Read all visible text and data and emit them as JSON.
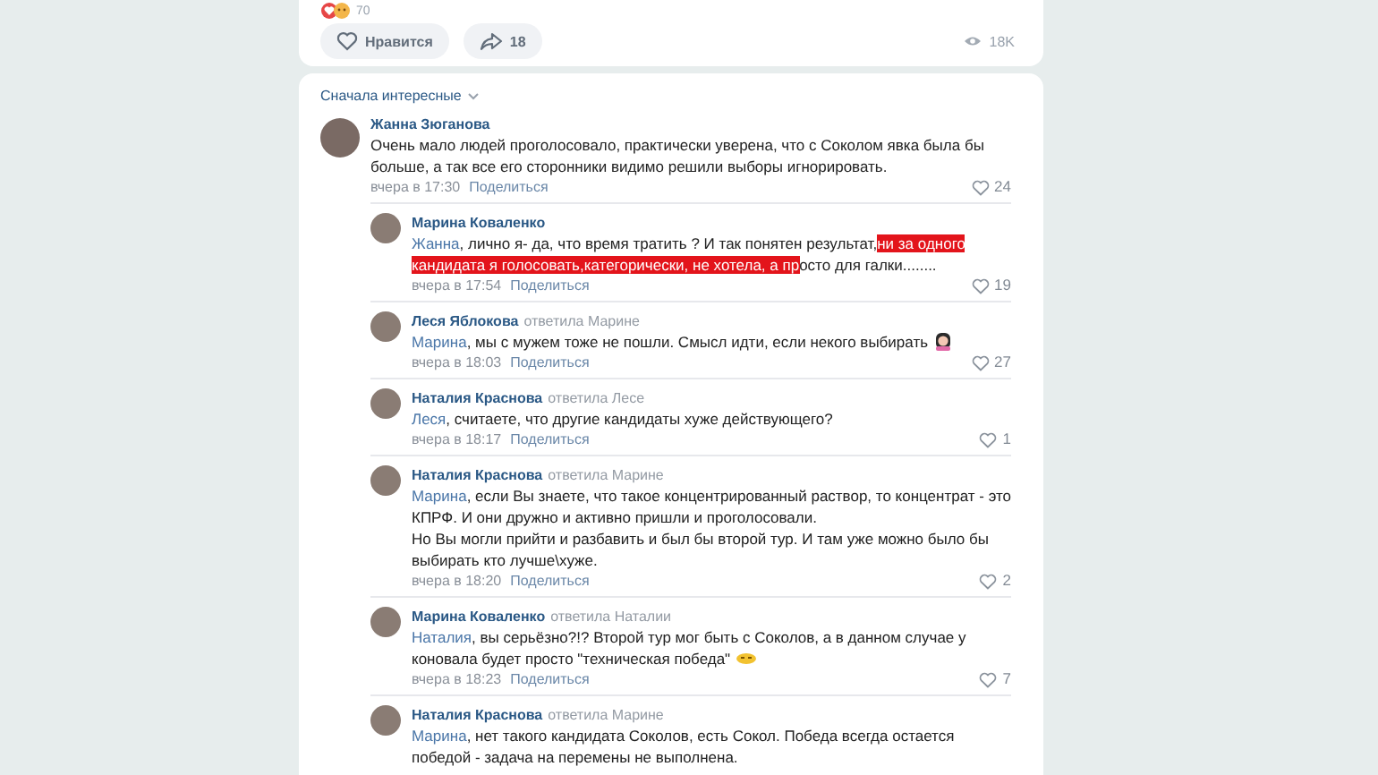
{
  "post": {
    "reactions_count": "70",
    "like_button": {
      "label": "Нравится"
    },
    "share_button": {
      "count": "18"
    },
    "views": "18K"
  },
  "comments": {
    "sort": "Сначала интересные",
    "items": [
      {
        "author": "Жанна Зюганова",
        "segments": [
          {
            "text": "Очень мало людей проголосовало, практически уверена, что с Соколом явка была бы больше, а так все его сторонники видимо решили выборы игнорировать.",
            "highlighted": false
          }
        ],
        "time": "вчера в 17:30",
        "share": "Поделиться",
        "likes": "24",
        "children": [
          {
            "author": "Марина Коваленко",
            "mention": "Жанна",
            "segments": [
              {
                "text": ", лично я- да, что время тратить ? И так понятен результат,",
                "highlighted": false
              },
              {
                "text": "ни за одного кандидата я голосовать,категорически, не хотела, а пр",
                "highlighted": true
              },
              {
                "text": "осто для галки........",
                "highlighted": false
              }
            ],
            "time": "вчера в 17:54",
            "share": "Поделиться",
            "likes": "19"
          },
          {
            "author": "Леся Яблокова",
            "reply_to": "ответила Марине",
            "mention": "Марина",
            "segments": [
              {
                "text": ", мы с мужем тоже не пошли. Смысл идти, если некого выбирать",
                "highlighted": false
              }
            ],
            "emoji": {
              "kind": "woman"
            },
            "time": "вчера в 18:03",
            "share": "Поделиться",
            "likes": "27"
          },
          {
            "author": "Наталия Краснова",
            "reply_to": "ответила Лесе",
            "mention": "Леся",
            "segments": [
              {
                "text": ", считаете, что другие кандидаты хуже действующего?",
                "highlighted": false
              }
            ],
            "time": "вчера в 18:17",
            "share": "Поделиться",
            "likes": "1"
          },
          {
            "author": "Наталия Краснова",
            "reply_to": "ответила Марине",
            "mention": "Марина",
            "segments": [
              {
                "text": ", если Вы знаете, что такое концентрированный раствор, то концентрат - это КПРФ. И они дружно и активно пришли и проголосовали.\nНо Вы могли прийти и разбавить и был бы второй тур. И там уже можно было бы выбирать кто лучше\\хуже.",
                "highlighted": false
              }
            ],
            "time": "вчера в 18:20",
            "share": "Поделиться",
            "likes": "2"
          },
          {
            "author": "Марина Коваленко",
            "reply_to": "ответила Наталии",
            "mention": "Наталия",
            "segments": [
              {
                "text": ", вы серьёзно?!? Второй тур мог быть с Соколов, а в данном случае у коновала будет просто \"техническая победа\"",
                "highlighted": false
              }
            ],
            "emoji": {
              "kind": "face"
            },
            "time": "вчера в 18:23",
            "share": "Поделиться",
            "likes": "7"
          },
          {
            "author": "Наталия Краснова",
            "reply_to": "ответила Марине",
            "mention": "Марина",
            "segments": [
              {
                "text": ", нет такого кандидата Соколов, есть Сокол. Победа всегда остается победой - задача на перемены не выполнена.",
                "highlighted": false
              }
            ]
          }
        ]
      }
    ]
  }
}
